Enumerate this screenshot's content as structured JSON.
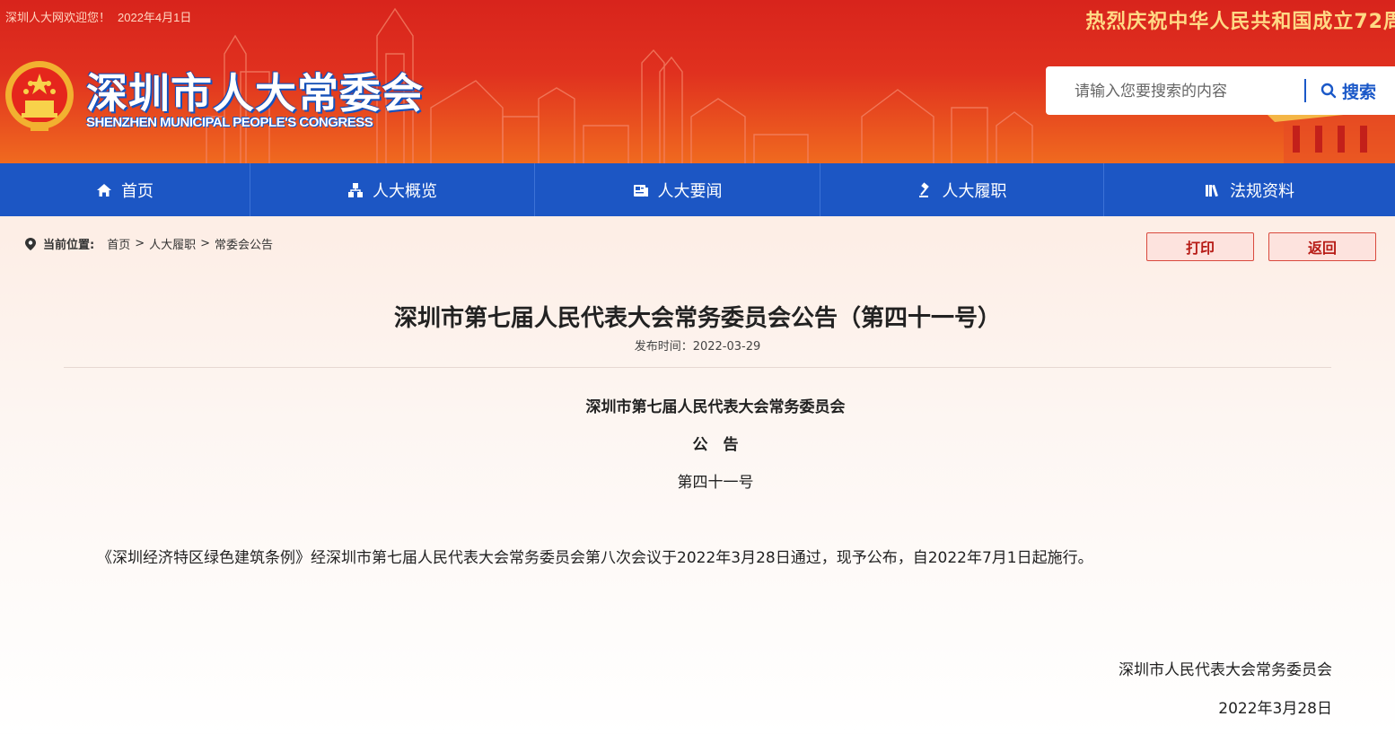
{
  "header": {
    "welcome": "深圳人大网欢迎您！",
    "date": "2022年4月1日",
    "celebrate": "热烈庆祝中华人民共和国成立72周",
    "site_title": "深圳市人大常委会",
    "site_subtitle": "SHENZHEN MUNICIPAL PEOPLE'S CONGRESS",
    "search_placeholder": "请输入您要搜索的内容",
    "search_button": "搜索"
  },
  "nav": {
    "items": [
      {
        "label": "首页",
        "icon": "home-icon"
      },
      {
        "label": "人大概览",
        "icon": "org-chart-icon"
      },
      {
        "label": "人大要闻",
        "icon": "news-icon"
      },
      {
        "label": "人大履职",
        "icon": "gavel-icon"
      },
      {
        "label": "法规资料",
        "icon": "books-icon"
      }
    ]
  },
  "breadcrumb": {
    "label": "当前位置:",
    "items": [
      "首页",
      "人大履职",
      "常委会公告"
    ],
    "separator": ">"
  },
  "actions": {
    "print": "打印",
    "back": "返回"
  },
  "article": {
    "title": "深圳市第七届人民代表大会常务委员会公告（第四十一号）",
    "meta_label": "发布时间：",
    "publish_date": "2022-03-29",
    "org": "深圳市第七届人民代表大会常务委员会",
    "kind": "公　告",
    "number": "第四十一号",
    "body": "《深圳经济特区绿色建筑条例》经深圳市第七届人民代表大会常务委员会第八次会议于2022年3月28日通过，现予公布，自2022年7月1日起施行。",
    "sign_org": "深圳市人民代表大会常务委员会",
    "sign_date": "2022年3月28日"
  },
  "colors": {
    "banner_red": "#d8241c",
    "nav_blue": "#1c56c4",
    "accent_red": "#b71c16"
  }
}
